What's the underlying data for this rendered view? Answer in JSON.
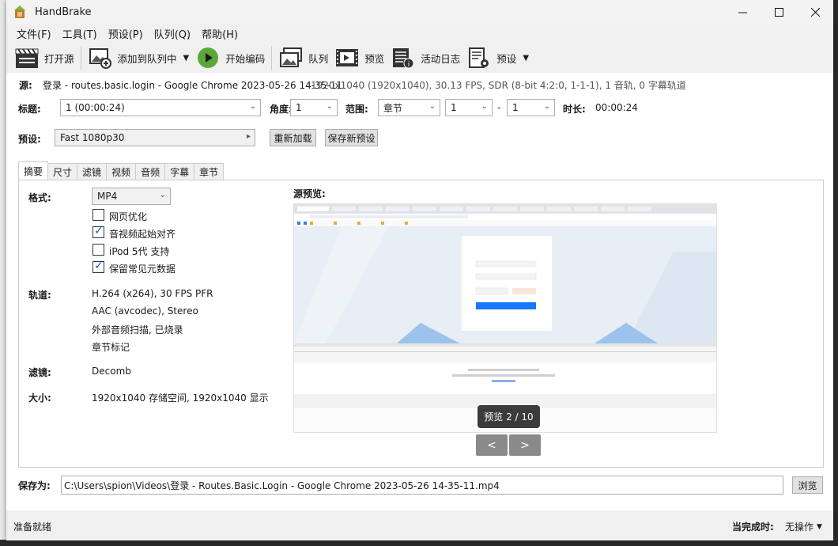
{
  "window": {
    "title": "HandBrake"
  },
  "menu": [
    "文件(F)",
    "工具(T)",
    "预设(P)",
    "队列(Q)",
    "帮助(H)"
  ],
  "toolbar": {
    "open_source": "打开源",
    "add_to_queue": "添加到队列中",
    "start_encode": "开始编码",
    "queue": "队列",
    "preview": "预览",
    "activity_log": "活动日志",
    "presets": "预设"
  },
  "source": {
    "label": "源:",
    "name": "登录 - routes.basic.login - Google Chrome 2023-05-26 14-35-11",
    "info": "1920x1040 (1920x1040), 30.13 FPS, SDR (8-bit 4:2:0, 1-1-1), 1 音轨, 0 字幕轨道"
  },
  "title_row": {
    "title_label": "标题:",
    "title_value": "1  (00:00:24)",
    "angle_label": "角度:",
    "angle_value": "1",
    "range_label": "范围:",
    "range_type": "章节",
    "range_start": "1",
    "range_sep": "-",
    "range_end": "1",
    "duration_label": "时长:",
    "duration_value": "00:00:24"
  },
  "preset_row": {
    "label": "预设:",
    "value": "Fast 1080p30",
    "reload": "重新加载",
    "save_new": "保存新预设"
  },
  "tabs": [
    "摘要",
    "尺寸",
    "滤镜",
    "视频",
    "音频",
    "字幕",
    "章节"
  ],
  "summary": {
    "format_label": "格式:",
    "format_value": "MP4",
    "options": [
      {
        "label": "网页优化",
        "checked": false
      },
      {
        "label": "音视频起始对齐",
        "checked": true
      },
      {
        "label": "iPod 5代 支持",
        "checked": false
      },
      {
        "label": "保留常见元数据",
        "checked": true
      }
    ],
    "tracks_label": "轨道:",
    "tracks": [
      "H.264 (x264), 30 FPS PFR",
      "AAC (avcodec), Stereo",
      "外部音频扫描, 已烧录",
      "章节标记"
    ],
    "filters_label": "滤镜:",
    "filters_value": "Decomb",
    "size_label": "大小:",
    "size_value": "1920x1040 存储空间, 1920x1040 显示",
    "preview_title": "源预览:",
    "preview_counter": "预览 2 / 10",
    "prev": "<",
    "next": ">"
  },
  "save": {
    "label": "保存为:",
    "path": "C:\\Users\\spion\\Videos\\登录 - Routes.Basic.Login - Google Chrome 2023-05-26 14-35-11.mp4",
    "browse": "浏览"
  },
  "status": {
    "ready": "准备就绪",
    "when_done_label": "当完成时:",
    "when_done_value": "无操作"
  }
}
